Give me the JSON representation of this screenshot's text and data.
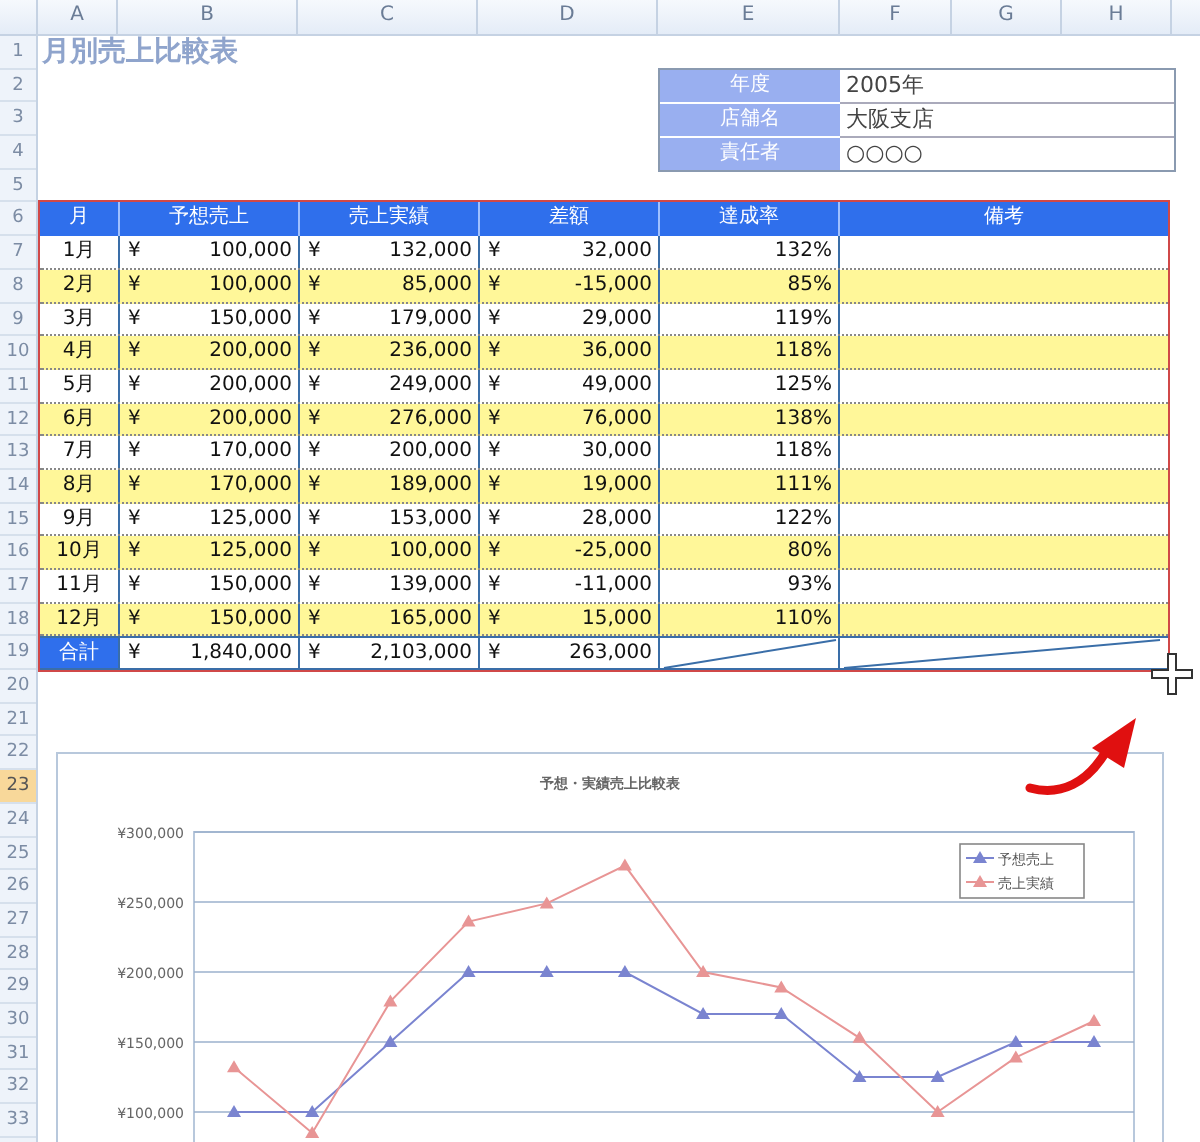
{
  "sheet": {
    "column_headers": [
      "A",
      "B",
      "C",
      "D",
      "E",
      "F",
      "G",
      "H"
    ],
    "row_numbers": [
      {
        "label": "1",
        "selected": false
      },
      {
        "label": "2",
        "selected": false
      },
      {
        "label": "3",
        "selected": false
      },
      {
        "label": "4",
        "selected": false
      },
      {
        "label": "5",
        "selected": false
      },
      {
        "label": "6",
        "selected": false
      },
      {
        "label": "7",
        "selected": false
      },
      {
        "label": "8",
        "selected": false
      },
      {
        "label": "9",
        "selected": false
      },
      {
        "label": "10",
        "selected": false
      },
      {
        "label": "11",
        "selected": false
      },
      {
        "label": "12",
        "selected": false
      },
      {
        "label": "13",
        "selected": false
      },
      {
        "label": "14",
        "selected": false
      },
      {
        "label": "15",
        "selected": false
      },
      {
        "label": "16",
        "selected": false
      },
      {
        "label": "17",
        "selected": false
      },
      {
        "label": "18",
        "selected": false
      },
      {
        "label": "19",
        "selected": false
      },
      {
        "label": "20",
        "selected": false
      },
      {
        "label": "21",
        "selected": false
      },
      {
        "label": "22",
        "selected": false
      },
      {
        "label": "23",
        "selected": true
      },
      {
        "label": "24",
        "selected": false
      },
      {
        "label": "25",
        "selected": false
      },
      {
        "label": "26",
        "selected": false
      },
      {
        "label": "27",
        "selected": false
      },
      {
        "label": "28",
        "selected": false
      },
      {
        "label": "29",
        "selected": false
      },
      {
        "label": "30",
        "selected": false
      },
      {
        "label": "31",
        "selected": false
      },
      {
        "label": "32",
        "selected": false
      },
      {
        "label": "33",
        "selected": false
      }
    ]
  },
  "title": "月別売上比較表",
  "info": [
    {
      "label": "年度",
      "value": "2005年"
    },
    {
      "label": "店舗名",
      "value": "大阪支店"
    },
    {
      "label": "責任者",
      "value": "○○○○"
    }
  ],
  "table": {
    "columns": [
      "月",
      "予想売上",
      "売上実績",
      "差額",
      "達成率",
      "備考"
    ],
    "rows": [
      {
        "month": "1月",
        "forecast": [
          "¥",
          "100,000"
        ],
        "actual": [
          "¥",
          "132,000"
        ],
        "diff": [
          "¥",
          "32,000"
        ],
        "rate": "132%",
        "shaded": false
      },
      {
        "month": "2月",
        "forecast": [
          "¥",
          "100,000"
        ],
        "actual": [
          "¥",
          "85,000"
        ],
        "diff": [
          "¥",
          "-15,000"
        ],
        "rate": "85%",
        "shaded": true
      },
      {
        "month": "3月",
        "forecast": [
          "¥",
          "150,000"
        ],
        "actual": [
          "¥",
          "179,000"
        ],
        "diff": [
          "¥",
          "29,000"
        ],
        "rate": "119%",
        "shaded": false
      },
      {
        "month": "4月",
        "forecast": [
          "¥",
          "200,000"
        ],
        "actual": [
          "¥",
          "236,000"
        ],
        "diff": [
          "¥",
          "36,000"
        ],
        "rate": "118%",
        "shaded": true
      },
      {
        "month": "5月",
        "forecast": [
          "¥",
          "200,000"
        ],
        "actual": [
          "¥",
          "249,000"
        ],
        "diff": [
          "¥",
          "49,000"
        ],
        "rate": "125%",
        "shaded": false
      },
      {
        "month": "6月",
        "forecast": [
          "¥",
          "200,000"
        ],
        "actual": [
          "¥",
          "276,000"
        ],
        "diff": [
          "¥",
          "76,000"
        ],
        "rate": "138%",
        "shaded": true
      },
      {
        "month": "7月",
        "forecast": [
          "¥",
          "170,000"
        ],
        "actual": [
          "¥",
          "200,000"
        ],
        "diff": [
          "¥",
          "30,000"
        ],
        "rate": "118%",
        "shaded": false
      },
      {
        "month": "8月",
        "forecast": [
          "¥",
          "170,000"
        ],
        "actual": [
          "¥",
          "189,000"
        ],
        "diff": [
          "¥",
          "19,000"
        ],
        "rate": "111%",
        "shaded": true
      },
      {
        "month": "9月",
        "forecast": [
          "¥",
          "125,000"
        ],
        "actual": [
          "¥",
          "153,000"
        ],
        "diff": [
          "¥",
          "28,000"
        ],
        "rate": "122%",
        "shaded": false
      },
      {
        "month": "10月",
        "forecast": [
          "¥",
          "125,000"
        ],
        "actual": [
          "¥",
          "100,000"
        ],
        "diff": [
          "¥",
          "-25,000"
        ],
        "rate": "80%",
        "shaded": true
      },
      {
        "month": "11月",
        "forecast": [
          "¥",
          "150,000"
        ],
        "actual": [
          "¥",
          "139,000"
        ],
        "diff": [
          "¥",
          "-11,000"
        ],
        "rate": "93%",
        "shaded": false
      },
      {
        "month": "12月",
        "forecast": [
          "¥",
          "150,000"
        ],
        "actual": [
          "¥",
          "165,000"
        ],
        "diff": [
          "¥",
          "15,000"
        ],
        "rate": "110%",
        "shaded": true
      }
    ],
    "total": {
      "label": "合計",
      "forecast": [
        "¥",
        "1,840,000"
      ],
      "actual": [
        "¥",
        "2,103,000"
      ],
      "diff": [
        "¥",
        "263,000"
      ]
    }
  },
  "chart": {
    "chart_data": {
      "type": "line",
      "title": "予想・実績売上比較表",
      "ylim": [
        0,
        300000
      ],
      "grid": true,
      "legend": true,
      "yticks": [
        {
          "value": 100000,
          "label": "¥100,000"
        },
        {
          "value": 150000,
          "label": "¥150,000"
        },
        {
          "value": 200000,
          "label": "¥200,000"
        },
        {
          "value": 250000,
          "label": "¥250,000"
        },
        {
          "value": 300000,
          "label": "¥300,000"
        }
      ],
      "series": [
        {
          "name": "予想売上",
          "color": "#7a84d0",
          "marker": "triangle",
          "values": [
            100000,
            100000,
            150000,
            200000,
            200000,
            200000,
            170000,
            170000,
            125000,
            125000,
            150000,
            150000
          ]
        },
        {
          "name": "売上実績",
          "color": "#e89595",
          "marker": "triangle",
          "values": [
            132000,
            85000,
            179000,
            236000,
            249000,
            276000,
            200000,
            189000,
            153000,
            100000,
            139000,
            165000
          ]
        }
      ]
    }
  }
}
